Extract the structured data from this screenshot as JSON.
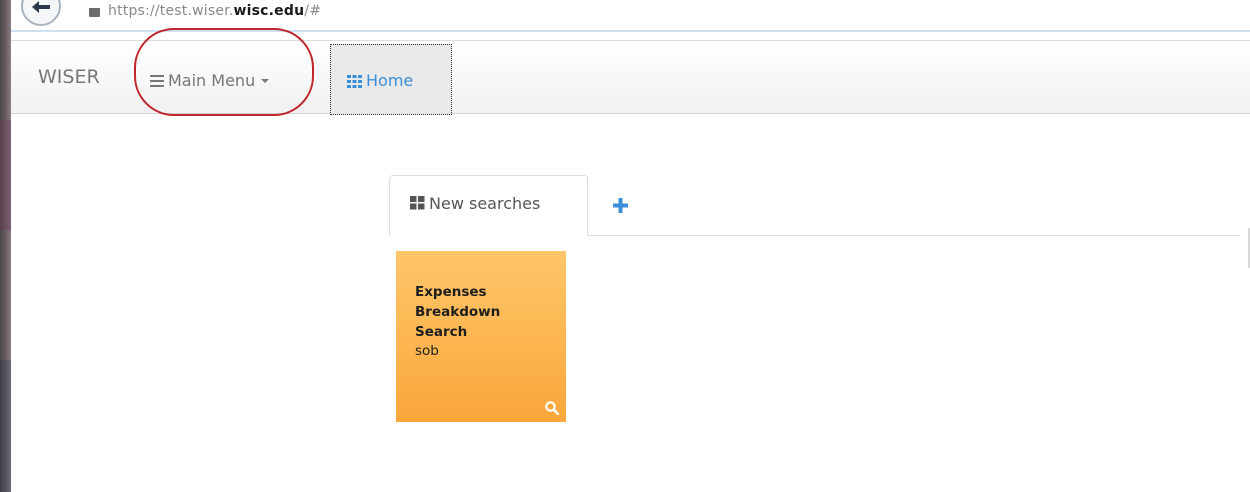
{
  "browser": {
    "url_prefix": "https://test.wiser.",
    "url_domain": "wisc.edu",
    "url_suffix": "/#"
  },
  "navbar": {
    "brand": "WISER",
    "main_menu_label": "Main Menu",
    "home_label": "Home"
  },
  "tabs": [
    {
      "label": "New searches",
      "active": true
    }
  ],
  "tiles": [
    {
      "title": "Expenses Breakdown Search",
      "subtitle": "sob",
      "color": "#f9a73a"
    }
  ],
  "colors": {
    "accent": "#3b8fd9",
    "highlight": "#c0252b",
    "tile": "#f9a73a"
  },
  "icons": {
    "back": "back-arrow-icon",
    "lock": "lock-icon",
    "menu": "hamburger-icon",
    "home": "grid-icon",
    "tab": "th-large-icon",
    "add": "plus-icon",
    "search": "search-icon"
  }
}
